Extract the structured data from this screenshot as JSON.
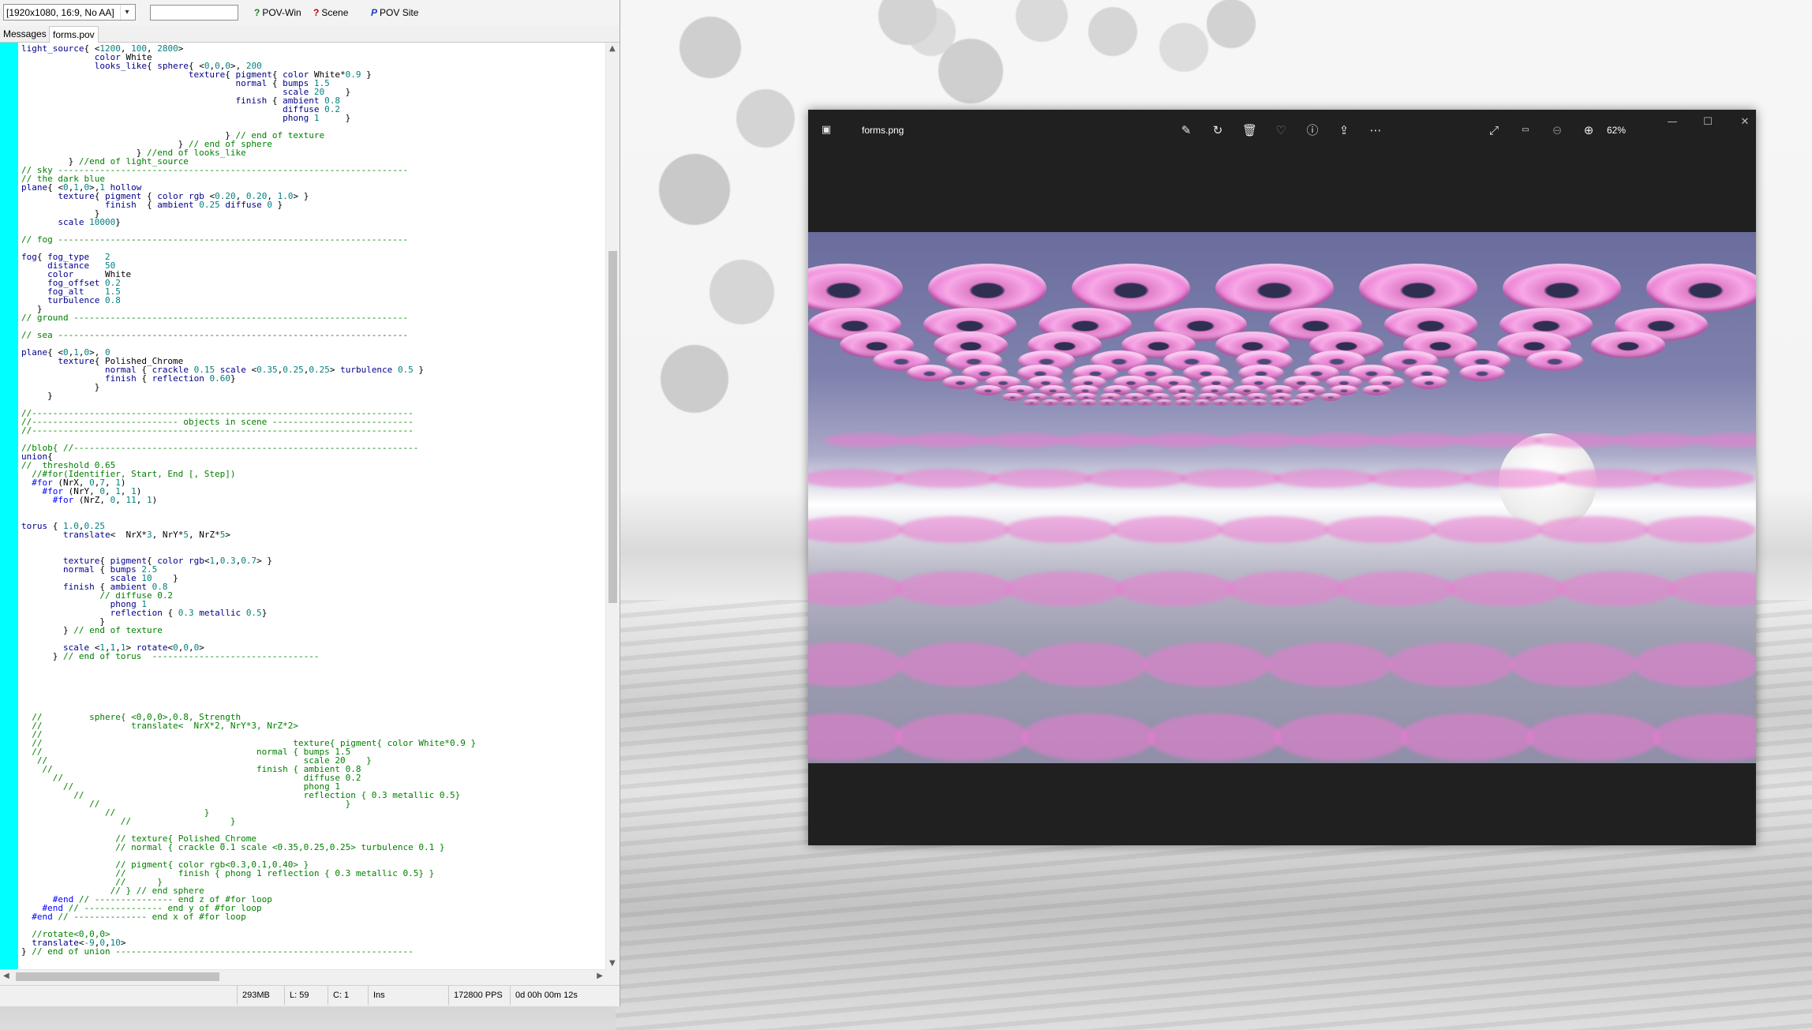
{
  "pov_window": {
    "resolution_select": "[1920x1080, 16:9, No AA]",
    "command_input": "",
    "toolbar_buttons": [
      "POV-Win",
      "Scene",
      "POV Site"
    ],
    "tabs": [
      "Messages",
      "forms.pov"
    ],
    "active_tab": "forms.pov",
    "status": {
      "memory": "293MB",
      "line": "L: 59",
      "column": "C: 1",
      "mode": "Ins",
      "pps": "172800 PPS",
      "time": "0d 00h 00m 12s"
    }
  },
  "code_lines": [
    "light_source{ <1200, 100, 2800>",
    "              color White",
    "              looks_like{ sphere{ <0,0,0>, 200",
    "                                texture{ pigment{ color White*0.9 }",
    "                                         normal { bumps 1.5",
    "                                                  scale 20    }",
    "                                         finish { ambient 0.8",
    "                                                  diffuse 0.2",
    "                                                  phong 1     }",
    "",
    "                                       } // end of texture",
    "                              } // end of sphere",
    "                      } //end of looks_like",
    "         } //end of light_source",
    "// sky -------------------------------------------------------------------",
    "// the dark blue",
    "plane{ <0,1,0>,1 hollow",
    "       texture{ pigment { color rgb <0.20, 0.20, 1.0> }",
    "                finish  { ambient 0.25 diffuse 0 }",
    "              }",
    "       scale 10000}",
    "",
    "// fog -------------------------------------------------------------------",
    "",
    "fog{ fog_type   2",
    "     distance   50",
    "     color      White",
    "     fog_offset 0.2",
    "     fog_alt    1.5",
    "     turbulence 0.8",
    "   }",
    "// ground ----------------------------------------------------------------",
    "",
    "// sea -------------------------------------------------------------------",
    "",
    "plane{ <0,1,0>, 0",
    "       texture{ Polished_Chrome",
    "                normal { crackle 0.15 scale <0.35,0.25,0.25> turbulence 0.5 }",
    "                finish { reflection 0.60}",
    "              }",
    "     }",
    "",
    "//-------------------------------------------------------------------------",
    "//---------------------------- objects in scene ---------------------------",
    "//-------------------------------------------------------------------------",
    "",
    "//blob{ //------------------------------------------------------------------",
    "union{",
    "//  threshold 0.65",
    "  //#for(Identifier, Start, End [, Step])",
    "  #for (NrX, 0,7, 1)",
    "    #for (NrY, 0, 1, 1)",
    "      #for (NrZ, 0, 11, 1)",
    "",
    "",
    "torus { 1.0,0.25",
    "        translate<  NrX*3, NrY*5, NrZ*5>",
    "",
    "",
    "        texture{ pigment{ color rgb<1,0.3,0.7> }",
    "        normal { bumps 2.5",
    "                 scale 10    }",
    "        finish { ambient 0.8",
    "               // diffuse 0.2",
    "                 phong 1",
    "                 reflection { 0.3 metallic 0.5}",
    "               }",
    "        } // end of texture",
    "",
    "        scale <1,1,1> rotate<0,0,0>",
    "      } // end of torus  --------------------------------",
    "",
    "",
    "",
    "",
    "",
    "",
    "  //         sphere{ <0,0,0>,0.8, Strength",
    "  //                 translate<  NrX*2, NrY*3, NrZ*2>",
    "  //",
    "  //                                                texture{ pigment{ color White*0.9 }",
    "  //                                         normal { bumps 1.5",
    "   //                                                 scale 20    }",
    "    //                                       finish { ambient 0.8",
    "      //                                              diffuse 0.2",
    "        //                                            phong 1",
    "          //                                          reflection { 0.3 metallic 0.5}",
    "             //                                               }",
    "                //                 }",
    "                   //                   }",
    "",
    "                  // texture{ Polished_Chrome",
    "                  // normal { crackle 0.1 scale <0.35,0.25,0.25> turbulence 0.1 }",
    "",
    "                  // pigment{ color rgb<0.3,0.1,0.40> }",
    "                  //          finish { phong 1 reflection { 0.3 metallic 0.5} }",
    "                  //      }",
    "                 // } // end sphere",
    "      #end // --------------- end z of #for loop",
    "    #end // --------------- end y of #for loop",
    "  #end // -------------- end x of #for loop",
    "",
    "  //rotate<0,0,0>",
    "  translate<-9,0,10>",
    "} // end of union ---------------------------------------------------------"
  ],
  "photos_window": {
    "title": "forms.png",
    "zoom": "62%",
    "toolbar_icons": [
      "edit-icon",
      "rotate-icon",
      "delete-icon",
      "favorite-icon",
      "info-icon",
      "share-icon",
      "more-icon",
      "fullscreen-icon",
      "actual-size-icon",
      "zoom-out-icon",
      "zoom-in-icon"
    ]
  },
  "colors": {
    "gutter": "#00ffff",
    "torus_pink": "#f2a0e0",
    "viewer_bg": "#202020",
    "sky": "#6a6c9c"
  }
}
